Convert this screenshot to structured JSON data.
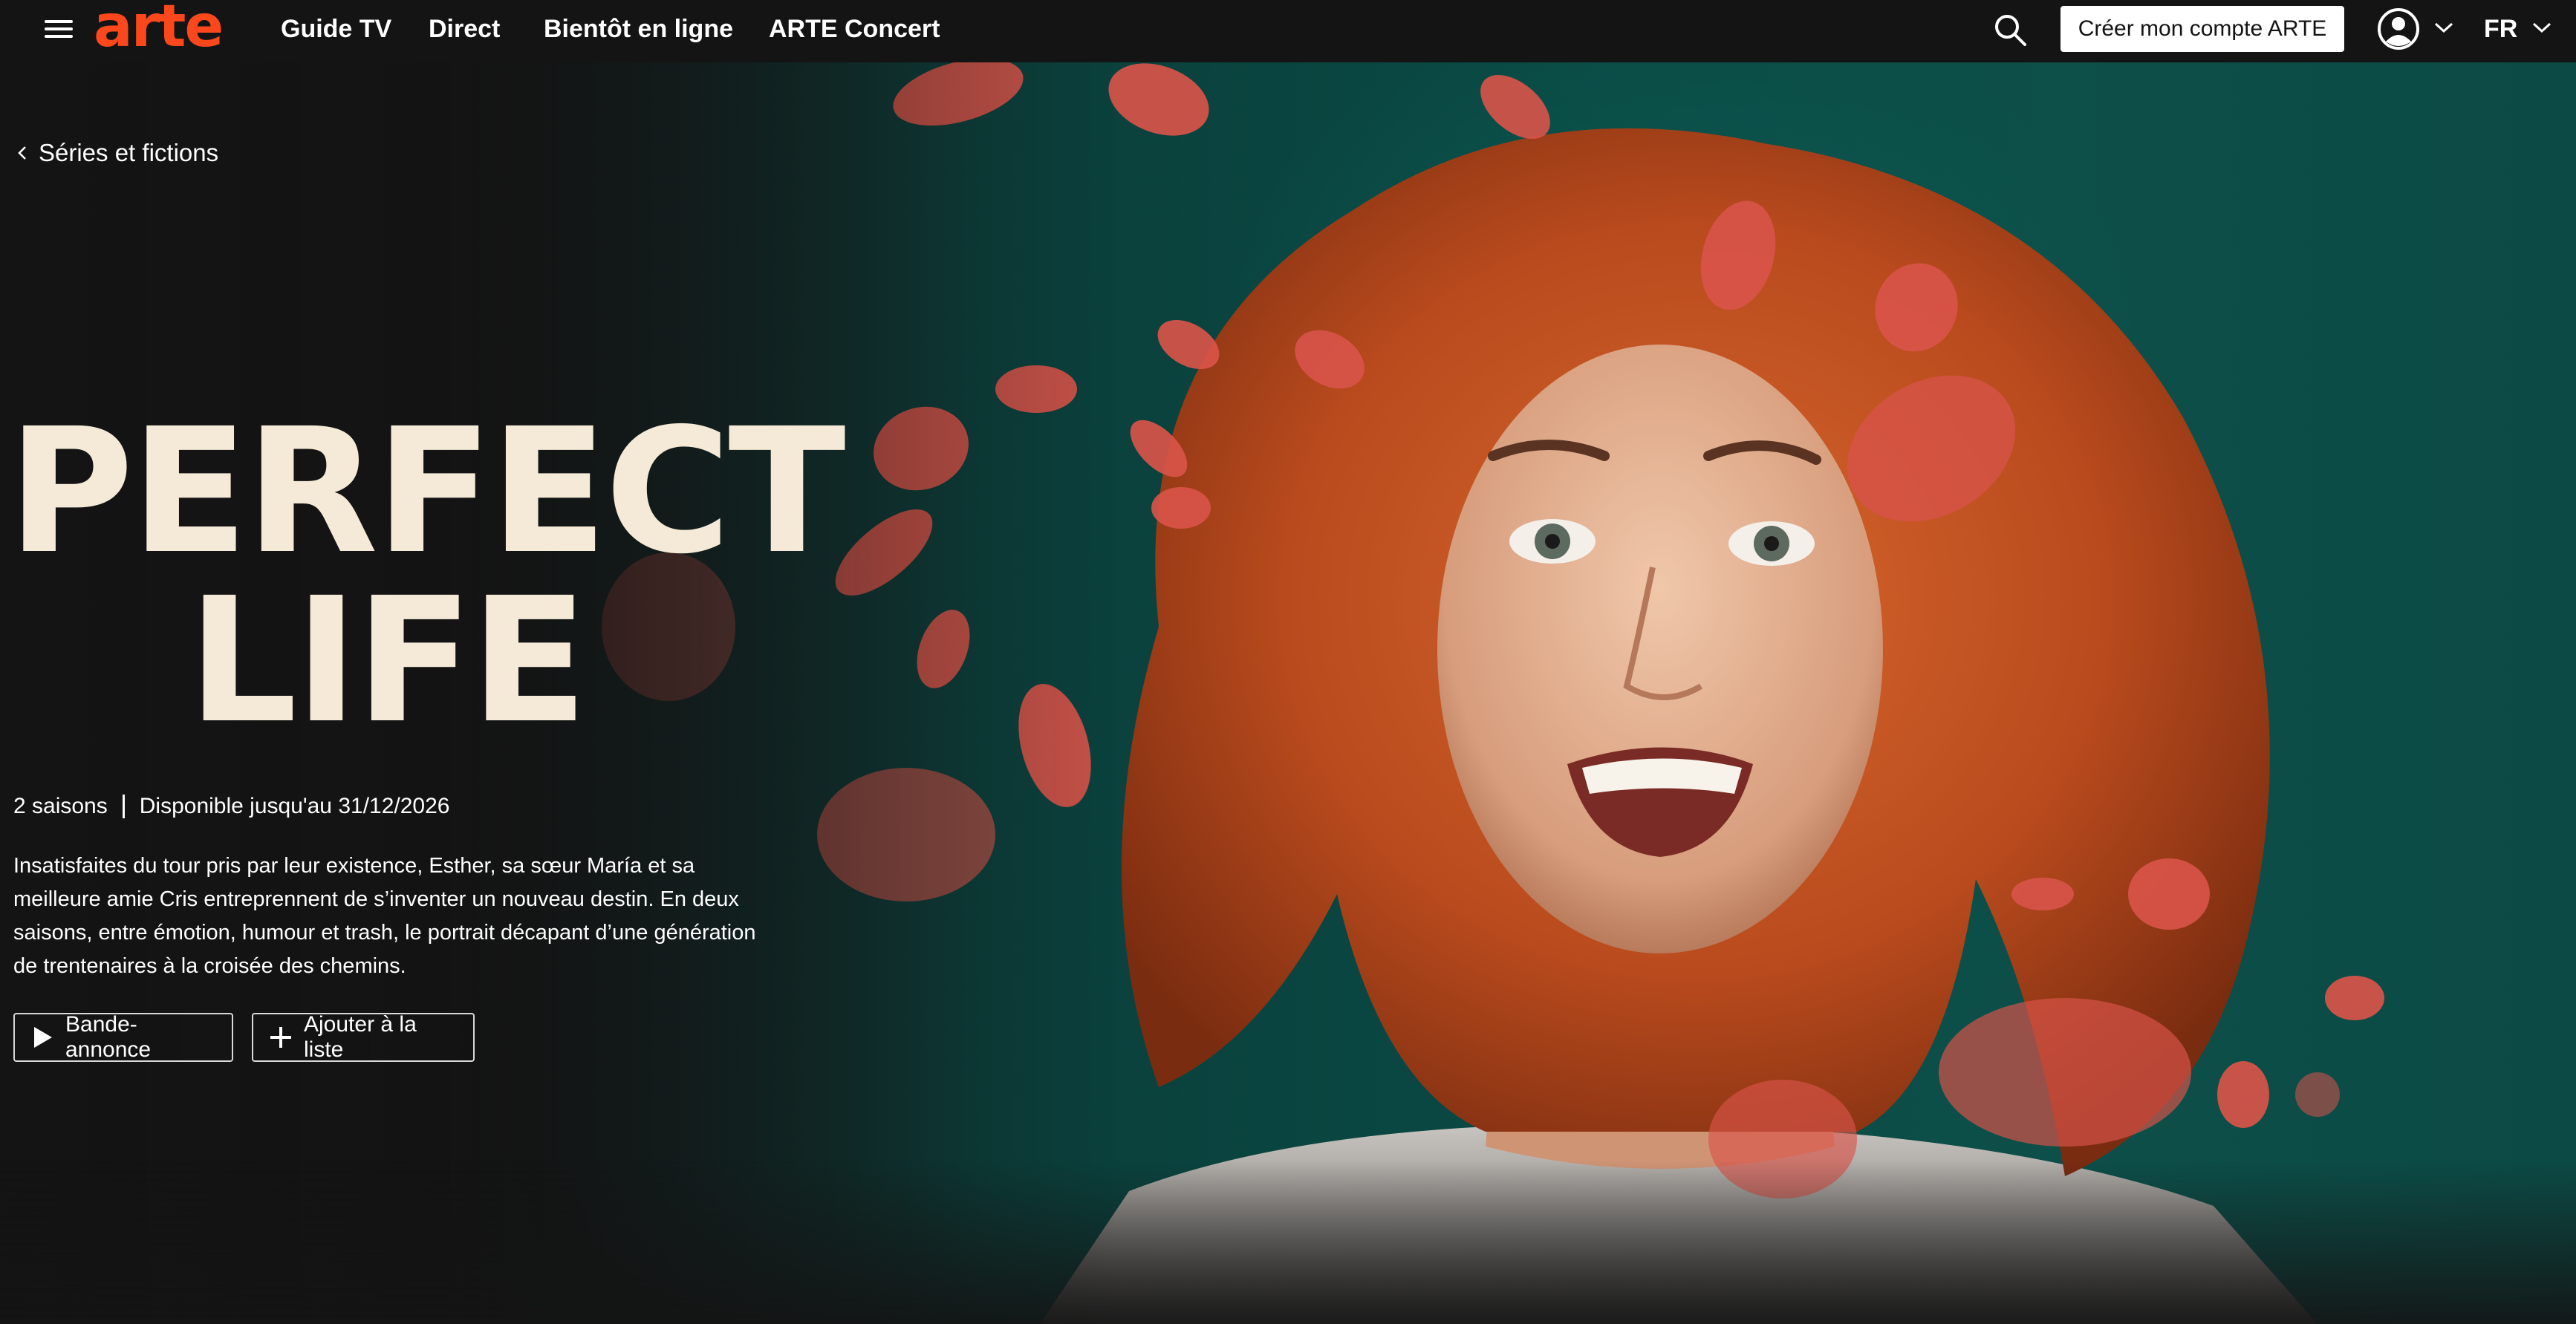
{
  "header": {
    "logo": "arte",
    "nav": [
      "Guide TV",
      "Direct",
      "Bientôt en ligne",
      "ARTE Concert"
    ],
    "account_button": "Créer mon compte ARTE",
    "language": "FR"
  },
  "breadcrumb": "Séries et fictions",
  "program": {
    "title_line1": "PERFECT",
    "title_line2": "LIFE",
    "seasons": "2 saisons",
    "availability": "Disponible jusqu'au 31/12/2026",
    "description": "Insatisfaites du tour pris par leur existence, Esther, sa sœur María et sa meilleure amie Cris entreprennent de s’inventer un nouveau destin. En deux saisons, entre émotion, humour et trash, le portrait décapant d’une génération de trentenaires à la croisée des chemins."
  },
  "actions": {
    "trailer": "Bande-annonce",
    "add_to_list": "Ajouter à la liste"
  },
  "colors": {
    "brand": "#fa481c",
    "background": "#141414",
    "hero_teal": "#0c4a45",
    "title": "#f5ead7"
  },
  "icons": {
    "menu": "menu-icon",
    "search": "search-icon",
    "user": "user-icon",
    "play": "play-icon",
    "plus": "plus-icon"
  }
}
